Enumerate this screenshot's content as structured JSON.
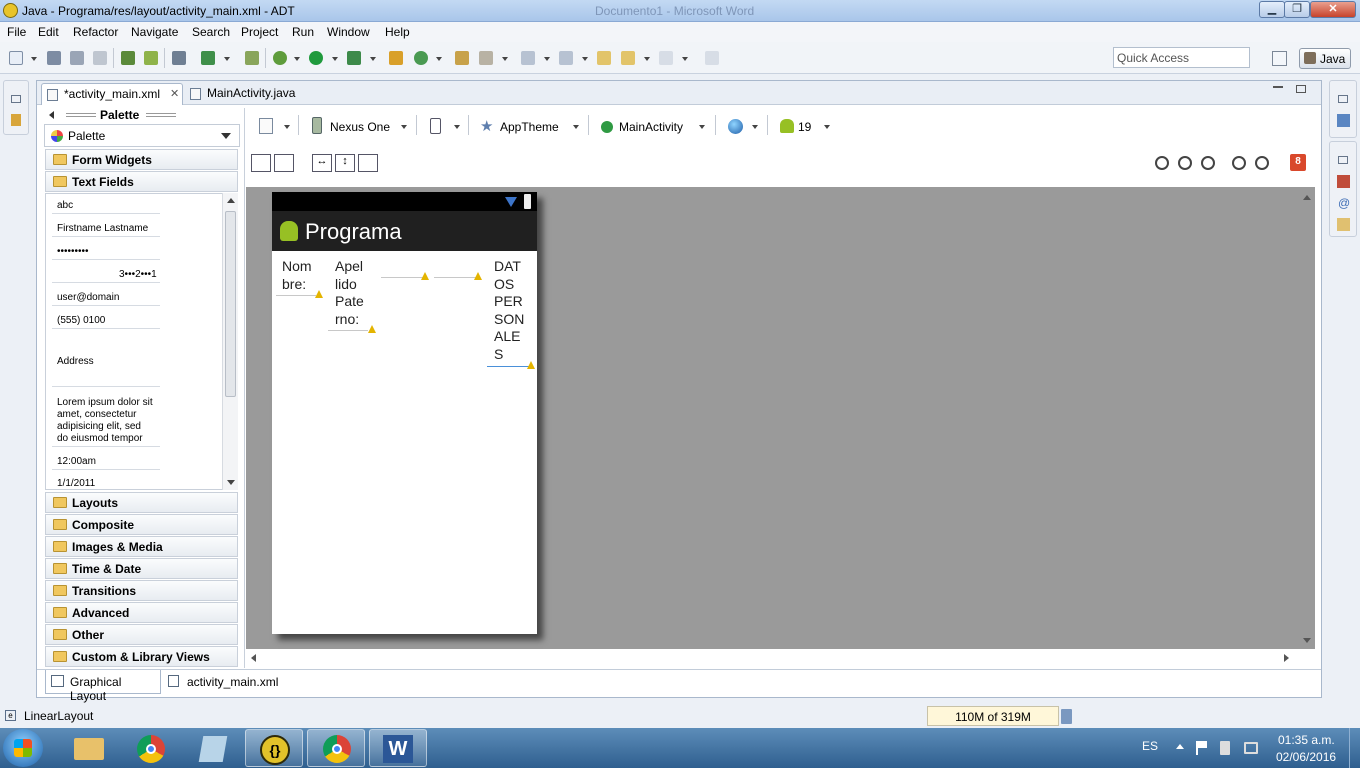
{
  "window": {
    "title": "Java - Programa/res/layout/activity_main.xml - ADT",
    "background_title": "Documento1 - Microsoft Word",
    "controls": {
      "minimize": "▁",
      "maximize": "❐",
      "close": "✕"
    }
  },
  "menu": [
    "File",
    "Edit",
    "Refactor",
    "Navigate",
    "Search",
    "Project",
    "Run",
    "Window",
    "Help"
  ],
  "toolbar": {
    "quick_access_placeholder": "Quick Access",
    "perspective": "Java"
  },
  "editor_tabs": [
    {
      "label": "*activity_main.xml",
      "close": "✕",
      "active": true
    },
    {
      "label": "MainActivity.java",
      "active": false
    }
  ],
  "palette": {
    "title": "Palette",
    "dropdown": "Palette",
    "categories_top": [
      "Form Widgets",
      "Text Fields"
    ],
    "text_fields": [
      "abc",
      "Firstname Lastname",
      "•••••••••",
      "3•••2•••1",
      "user@domain",
      "(555) 0100",
      "Address",
      "Lorem ipsum dolor sit",
      "amet, consectetur",
      "adipisicing elit, sed",
      "do eiusmod tempor",
      "12:00am",
      "1/1/2011"
    ],
    "categories_bottom": [
      "Layouts",
      "Composite",
      "Images & Media",
      "Time & Date",
      "Transitions",
      "Advanced",
      "Other",
      "Custom & Library Views"
    ]
  },
  "layout_toolbar": {
    "device": "Nexus One",
    "theme": "AppTheme",
    "activity": "MainActivity",
    "api": "19",
    "error_badge": "8"
  },
  "preview": {
    "app_title": "Programa",
    "label_nombre": [
      "Nom",
      "bre:"
    ],
    "label_apellido": [
      "Apel",
      "lido",
      "Pate",
      "rno:"
    ],
    "label_datos": [
      "DAT",
      "OS",
      "PER",
      "SON",
      "ALE",
      "S"
    ]
  },
  "bottom_tabs": [
    "Graphical Layout",
    "activity_main.xml"
  ],
  "status": {
    "selection": "LinearLayout",
    "heap": "110M of 319M"
  },
  "taskbar": {
    "language": "ES",
    "time": "01:35 a.m.",
    "date": "02/06/2016",
    "word_letter": "W"
  },
  "colors": {
    "canvas_bg": "#9a9a9a",
    "action_bar": "#202020",
    "warning": "#e4b400",
    "error_badge": "#d9482b",
    "android_green": "#97c024"
  }
}
